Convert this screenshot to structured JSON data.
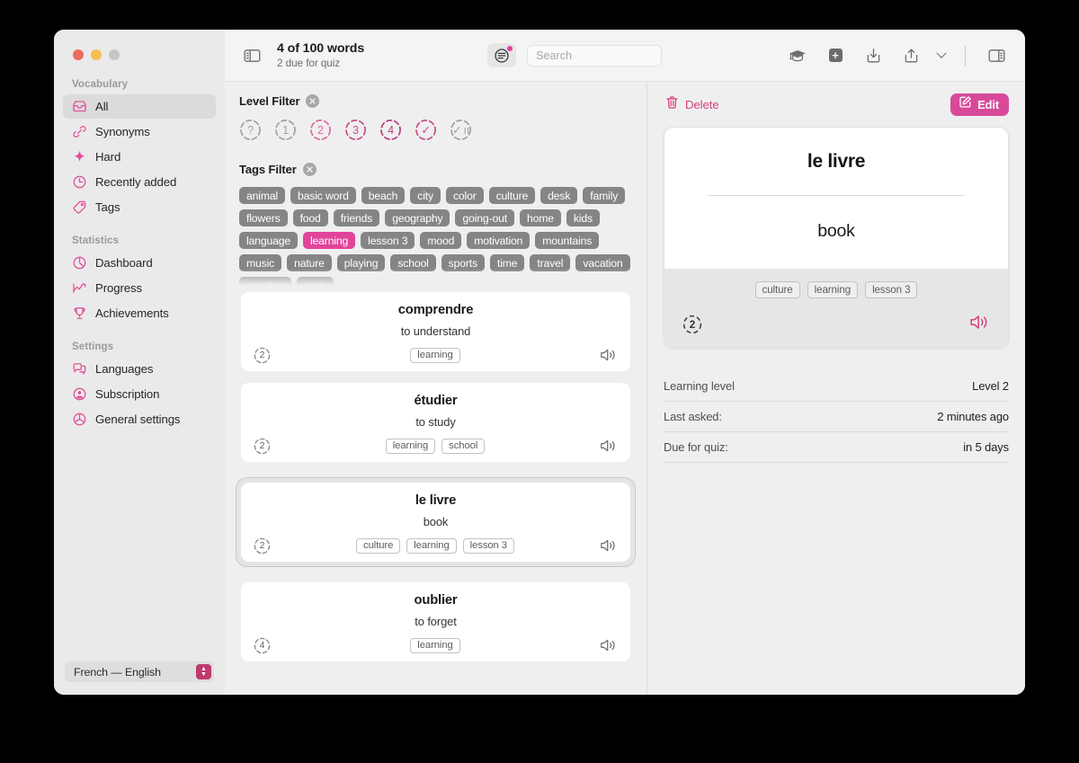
{
  "window": {
    "traffic_lights": [
      "close",
      "minimize",
      "zoom"
    ]
  },
  "sidebar": {
    "groups": [
      {
        "title": "Vocabulary",
        "items": [
          {
            "label": "All",
            "icon": "inbox-icon",
            "active": true
          },
          {
            "label": "Synonyms",
            "icon": "link-icon",
            "active": false
          },
          {
            "label": "Hard",
            "icon": "sparkle-icon",
            "active": false
          },
          {
            "label": "Recently added",
            "icon": "clock-icon",
            "active": false
          },
          {
            "label": "Tags",
            "icon": "tag-icon",
            "active": false
          }
        ]
      },
      {
        "title": "Statistics",
        "items": [
          {
            "label": "Dashboard",
            "icon": "pie-chart-icon",
            "active": false
          },
          {
            "label": "Progress",
            "icon": "chart-line-icon",
            "active": false
          },
          {
            "label": "Achievements",
            "icon": "trophy-icon",
            "active": false
          }
        ]
      },
      {
        "title": "Settings",
        "items": [
          {
            "label": "Languages",
            "icon": "speech-bubbles-icon",
            "active": false
          },
          {
            "label": "Subscription",
            "icon": "person-circle-icon",
            "active": false
          },
          {
            "label": "General settings",
            "icon": "gear-circle-icon",
            "active": false
          }
        ]
      }
    ],
    "language_selector": {
      "value": "French — English"
    }
  },
  "toolbar": {
    "sidebar_toggle_icon": "sidebar-left-icon",
    "title": "4 of 100 words",
    "subtitle": "2 due for quiz",
    "filter_icon": "filter-lines-icon",
    "filter_has_badge": true,
    "search": {
      "value": "",
      "placeholder": "Search"
    },
    "right_icons": [
      {
        "name": "graduation-cap-icon"
      },
      {
        "name": "add-square-icon"
      },
      {
        "name": "import-down-icon"
      },
      {
        "name": "share-up-icon"
      },
      {
        "name": "chevron-down-icon"
      },
      {
        "name": "sidebar-right-icon"
      }
    ]
  },
  "filters": {
    "level": {
      "title": "Level Filter",
      "clear_icon": "clear-circle-icon",
      "badges": [
        {
          "glyph": "?",
          "color": "#a2a1a1",
          "selected": false
        },
        {
          "glyph": "1",
          "color": "#a2a1a1",
          "selected": false
        },
        {
          "glyph": "2",
          "color": "#d86a9f",
          "selected": true
        },
        {
          "glyph": "3",
          "color": "#c74b8c",
          "selected": false
        },
        {
          "glyph": "4",
          "color": "#b83d80",
          "selected": false
        },
        {
          "glyph": "✓",
          "color": "#c74b8c",
          "selected": false
        },
        {
          "glyph": "✓ ıı",
          "color": "#a2a1a1",
          "selected": false
        }
      ]
    },
    "tags": {
      "title": "Tags Filter",
      "clear_icon": "clear-circle-icon",
      "pills": [
        {
          "label": "animal",
          "on": false
        },
        {
          "label": "basic word",
          "on": false
        },
        {
          "label": "beach",
          "on": false
        },
        {
          "label": "city",
          "on": false
        },
        {
          "label": "color",
          "on": false
        },
        {
          "label": "culture",
          "on": false
        },
        {
          "label": "desk",
          "on": false
        },
        {
          "label": "family",
          "on": false
        },
        {
          "label": "flowers",
          "on": false
        },
        {
          "label": "food",
          "on": false
        },
        {
          "label": "friends",
          "on": false
        },
        {
          "label": "geography",
          "on": false
        },
        {
          "label": "going-out",
          "on": false
        },
        {
          "label": "home",
          "on": false
        },
        {
          "label": "kids",
          "on": false
        },
        {
          "label": "language",
          "on": false
        },
        {
          "label": "learning",
          "on": true
        },
        {
          "label": "lesson 3",
          "on": false
        },
        {
          "label": "mood",
          "on": false
        },
        {
          "label": "motivation",
          "on": false
        },
        {
          "label": "mountains",
          "on": false
        },
        {
          "label": "music",
          "on": false
        },
        {
          "label": "nature",
          "on": false
        },
        {
          "label": "playing",
          "on": false
        },
        {
          "label": "school",
          "on": false
        },
        {
          "label": "sports",
          "on": false
        },
        {
          "label": "time",
          "on": false
        },
        {
          "label": "travel",
          "on": false
        },
        {
          "label": "vacation",
          "on": false
        },
        {
          "label": "weather",
          "on": false
        },
        {
          "label": "work",
          "on": false
        }
      ]
    }
  },
  "word_list": [
    {
      "term": "comprendre",
      "translation": "to understand",
      "level": "2",
      "tags": [
        "learning"
      ],
      "selected": false,
      "speaker_icon": "speaker-wave-icon"
    },
    {
      "term": "étudier",
      "translation": "to study",
      "level": "2",
      "tags": [
        "learning",
        "school"
      ],
      "selected": false,
      "speaker_icon": "speaker-wave-icon"
    },
    {
      "term": "le livre",
      "translation": "book",
      "level": "2",
      "tags": [
        "culture",
        "learning",
        "lesson 3"
      ],
      "selected": true,
      "speaker_icon": "speaker-wave-icon"
    },
    {
      "term": "oublier",
      "translation": "to forget",
      "level": "4",
      "tags": [
        "learning"
      ],
      "selected": false,
      "speaker_icon": "speaker-wave-icon"
    }
  ],
  "detail": {
    "delete_label": "Delete",
    "delete_icon": "trash-icon",
    "edit_label": "Edit",
    "edit_icon": "pencil-square-icon",
    "card": {
      "term": "le livre",
      "translation": "book",
      "tags": [
        "culture",
        "learning",
        "lesson 3"
      ],
      "level": "2",
      "speaker_icon": "speaker-wave-icon"
    },
    "info": [
      {
        "key": "Learning level",
        "value": "Level 2"
      },
      {
        "key": "Last asked:",
        "value": "2 minutes ago"
      },
      {
        "key": "Due for quiz:",
        "value": "in 5 days"
      }
    ]
  },
  "colors": {
    "accent_pink": "#e2449a",
    "accent_deep": "#d8499a",
    "icon_pink": "#e0509a",
    "sidebar_bg": "#ebeaea",
    "pane_bg": "#f0efef"
  }
}
